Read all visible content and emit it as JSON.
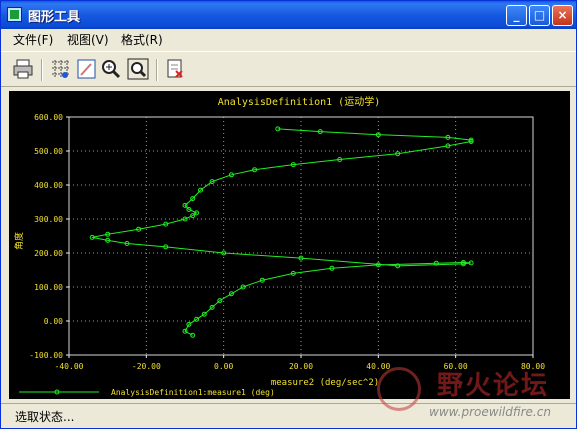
{
  "window": {
    "title": "图形工具",
    "minimize": "_",
    "maximize": "□",
    "close": "×"
  },
  "menu": [
    {
      "label": "文件(F)"
    },
    {
      "label": "视图(V)"
    },
    {
      "label": "格式(R)"
    }
  ],
  "toolbar": [
    {
      "icon": "print-icon"
    },
    {
      "icon": "grid-icon"
    },
    {
      "icon": "edit-icon"
    },
    {
      "icon": "zoom-in-icon"
    },
    {
      "icon": "zoom-fit-icon"
    },
    {
      "icon": "export-icon"
    }
  ],
  "status": {
    "text": "选取状态..."
  },
  "watermark": {
    "main": "野火论坛",
    "url": "www.proewildfire.cn"
  },
  "chart_data": {
    "type": "line",
    "title": "AnalysisDefinition1 (运动学)",
    "xlabel": "measure2 (deg/sec^2)",
    "ylabel": "角度",
    "xlim": [
      -40,
      80
    ],
    "ylim": [
      -100,
      600
    ],
    "x_ticks": [
      "-40.00",
      "-20.00",
      "0.00",
      "20.00",
      "40.00",
      "60.00",
      "80.00"
    ],
    "y_ticks": [
      "-100.00",
      "0.00",
      "100.00",
      "200.00",
      "300.00",
      "400.00",
      "500.00",
      "600.00"
    ],
    "grid": true,
    "background": "#000000",
    "line_color": "#22ee22",
    "title_color": "#f0e030",
    "legend": "bottom-left",
    "series": [
      {
        "name": "AnalysisDefinition1:measure1 (deg)",
        "points": [
          [
            -8,
            -42
          ],
          [
            -10,
            -30
          ],
          [
            -9,
            -10
          ],
          [
            -7,
            5
          ],
          [
            -5,
            20
          ],
          [
            -3,
            40
          ],
          [
            -1,
            60
          ],
          [
            2,
            80
          ],
          [
            5,
            100
          ],
          [
            10,
            120
          ],
          [
            18,
            140
          ],
          [
            28,
            155
          ],
          [
            40,
            165
          ],
          [
            55,
            170
          ],
          [
            62,
            172
          ],
          [
            64,
            171
          ],
          [
            62,
            168
          ],
          [
            45,
            162
          ],
          [
            20,
            185
          ],
          [
            0,
            200
          ],
          [
            -15,
            218
          ],
          [
            -25,
            228
          ],
          [
            -30,
            237
          ],
          [
            -34,
            246
          ],
          [
            -30,
            255
          ],
          [
            -22,
            270
          ],
          [
            -15,
            285
          ],
          [
            -10,
            300
          ],
          [
            -8,
            310
          ],
          [
            -7,
            318
          ],
          [
            -9,
            328
          ],
          [
            -10,
            340
          ],
          [
            -8,
            360
          ],
          [
            -6,
            385
          ],
          [
            -3,
            410
          ],
          [
            2,
            430
          ],
          [
            8,
            445
          ],
          [
            18,
            460
          ],
          [
            30,
            475
          ],
          [
            45,
            492
          ],
          [
            58,
            515
          ],
          [
            64,
            528
          ],
          [
            64,
            532
          ],
          [
            58,
            540
          ],
          [
            40,
            548
          ],
          [
            25,
            557
          ],
          [
            14,
            565
          ]
        ]
      }
    ]
  }
}
